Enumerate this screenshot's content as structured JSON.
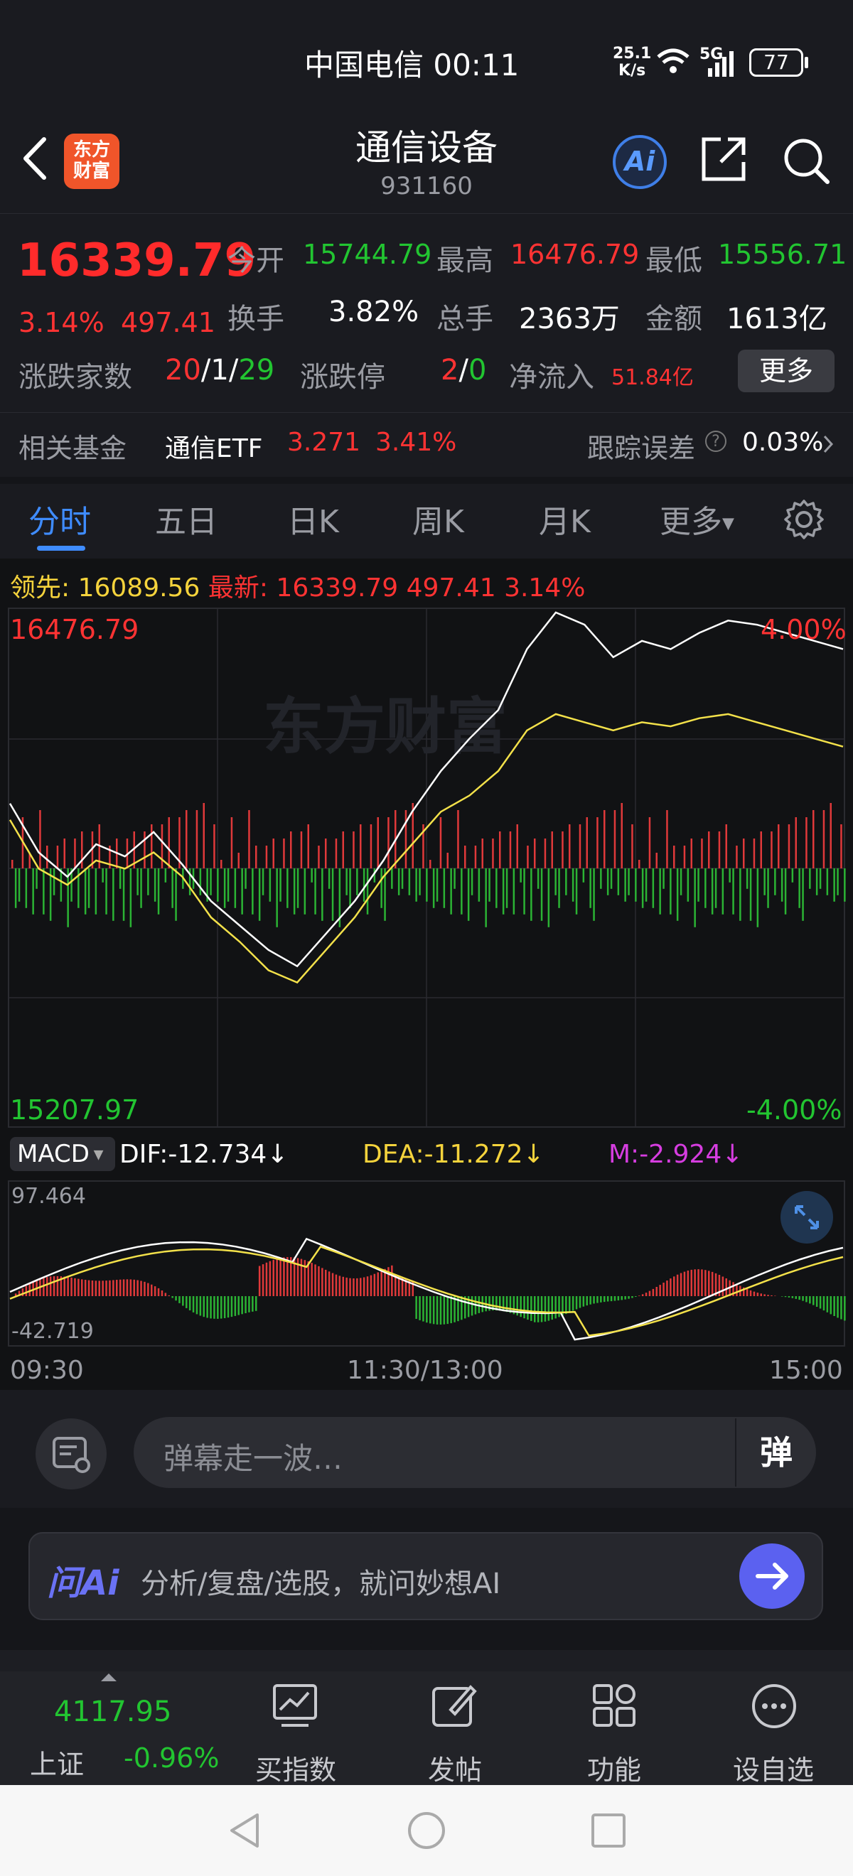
{
  "status_bar": {
    "carrier_time": "中国电信 00:11",
    "net_speed_value": "25.1",
    "net_speed_unit": "K/s",
    "network": "5G",
    "battery": "77"
  },
  "header": {
    "back_icon": "chevron-left-icon",
    "logo_line1": "东方",
    "logo_line2": "财富",
    "title": "通信设备",
    "code": "931160",
    "ai_label": "Ai",
    "share_icon": "share-icon",
    "search_icon": "search-icon"
  },
  "quote": {
    "price": "16339.79",
    "change_pct": "3.14%",
    "change_abs": "497.41",
    "open_label": "今开",
    "open_value": "15744.79",
    "high_label": "最高",
    "high_value": "16476.79",
    "low_label": "最低",
    "low_value": "15556.71",
    "turnover_label": "换手",
    "turnover_value": "3.82%",
    "volume_label": "总手",
    "volume_value": "2363万",
    "amount_label": "金额",
    "amount_value": "1613亿",
    "updown_label": "涨跌家数",
    "up_count": "20",
    "sep1": "/",
    "flat_count": "1",
    "sep2": "/",
    "down_count": "29",
    "limit_label": "涨跌停",
    "limit_up": "2",
    "sep3": "/",
    "limit_down": "0",
    "inflow_label": "净流入",
    "inflow_value": "51.84亿",
    "more_button": "更多"
  },
  "fund": {
    "label": "相关基金",
    "name": "通信ETF",
    "price": "3.271",
    "pct": "3.41%",
    "tracking_label": "跟踪误差",
    "tracking_value": "0.03%"
  },
  "tabs": [
    "分时",
    "五日",
    "日K",
    "周K",
    "月K",
    "更多"
  ],
  "ticker": {
    "lead_label": "领先:",
    "lead_value": "16089.56",
    "latest_label": "最新:",
    "latest_value": "16339.79",
    "change_abs": "497.41",
    "change_pct": "3.14%"
  },
  "chart_labels": {
    "high": "16476.79",
    "low": "15207.97",
    "high_pct": "4.00%",
    "low_pct": "-4.00%",
    "watermark": "东方财富",
    "macd_select": "MACD",
    "dif": "DIF:-12.734↓",
    "dea": "DEA:-11.272↓",
    "m": "M:-2.924↓",
    "macd_max": "97.464",
    "macd_min": "-42.719",
    "time_start": "09:30",
    "time_mid": "11:30/13:00",
    "time_end": "15:00"
  },
  "chart_data": {
    "type": "line",
    "ylim": [
      15207.97,
      16476.79
    ],
    "x_ticks": [
      "09:30",
      "11:30/13:00",
      "15:00"
    ],
    "series": [
      {
        "values": [
          16000,
          15880,
          15820,
          15900,
          15870,
          15930,
          15850,
          15760,
          15700,
          15640,
          15600,
          15680,
          15760,
          15860,
          15980,
          16080,
          16160,
          16230,
          16380,
          16470,
          16440,
          16360,
          16400,
          16380,
          16420,
          16450,
          16440,
          16420,
          16400,
          16380
        ]
      },
      {
        "values": [
          15960,
          15840,
          15800,
          15860,
          15840,
          15880,
          15820,
          15720,
          15660,
          15590,
          15560,
          15640,
          15720,
          15820,
          15900,
          15980,
          16020,
          16080,
          16180,
          16220,
          16200,
          16180,
          16200,
          16190,
          16210,
          16220,
          16200,
          16180,
          16160,
          16140
        ]
      }
    ],
    "macd_ylim": [
      -42.719,
      97.464
    ]
  },
  "danmu": {
    "placeholder": "弹幕走一波…",
    "send_label": "弹"
  },
  "ai_bar": {
    "logo": "问Ai",
    "placeholder": "分析/复盘/选股，就问妙想AI"
  },
  "bottom_nav": {
    "index_value": "4117.95",
    "index_name": "上证",
    "index_pct": "-0.96%",
    "items": [
      "买指数",
      "发帖",
      "功能",
      "设自选"
    ]
  }
}
